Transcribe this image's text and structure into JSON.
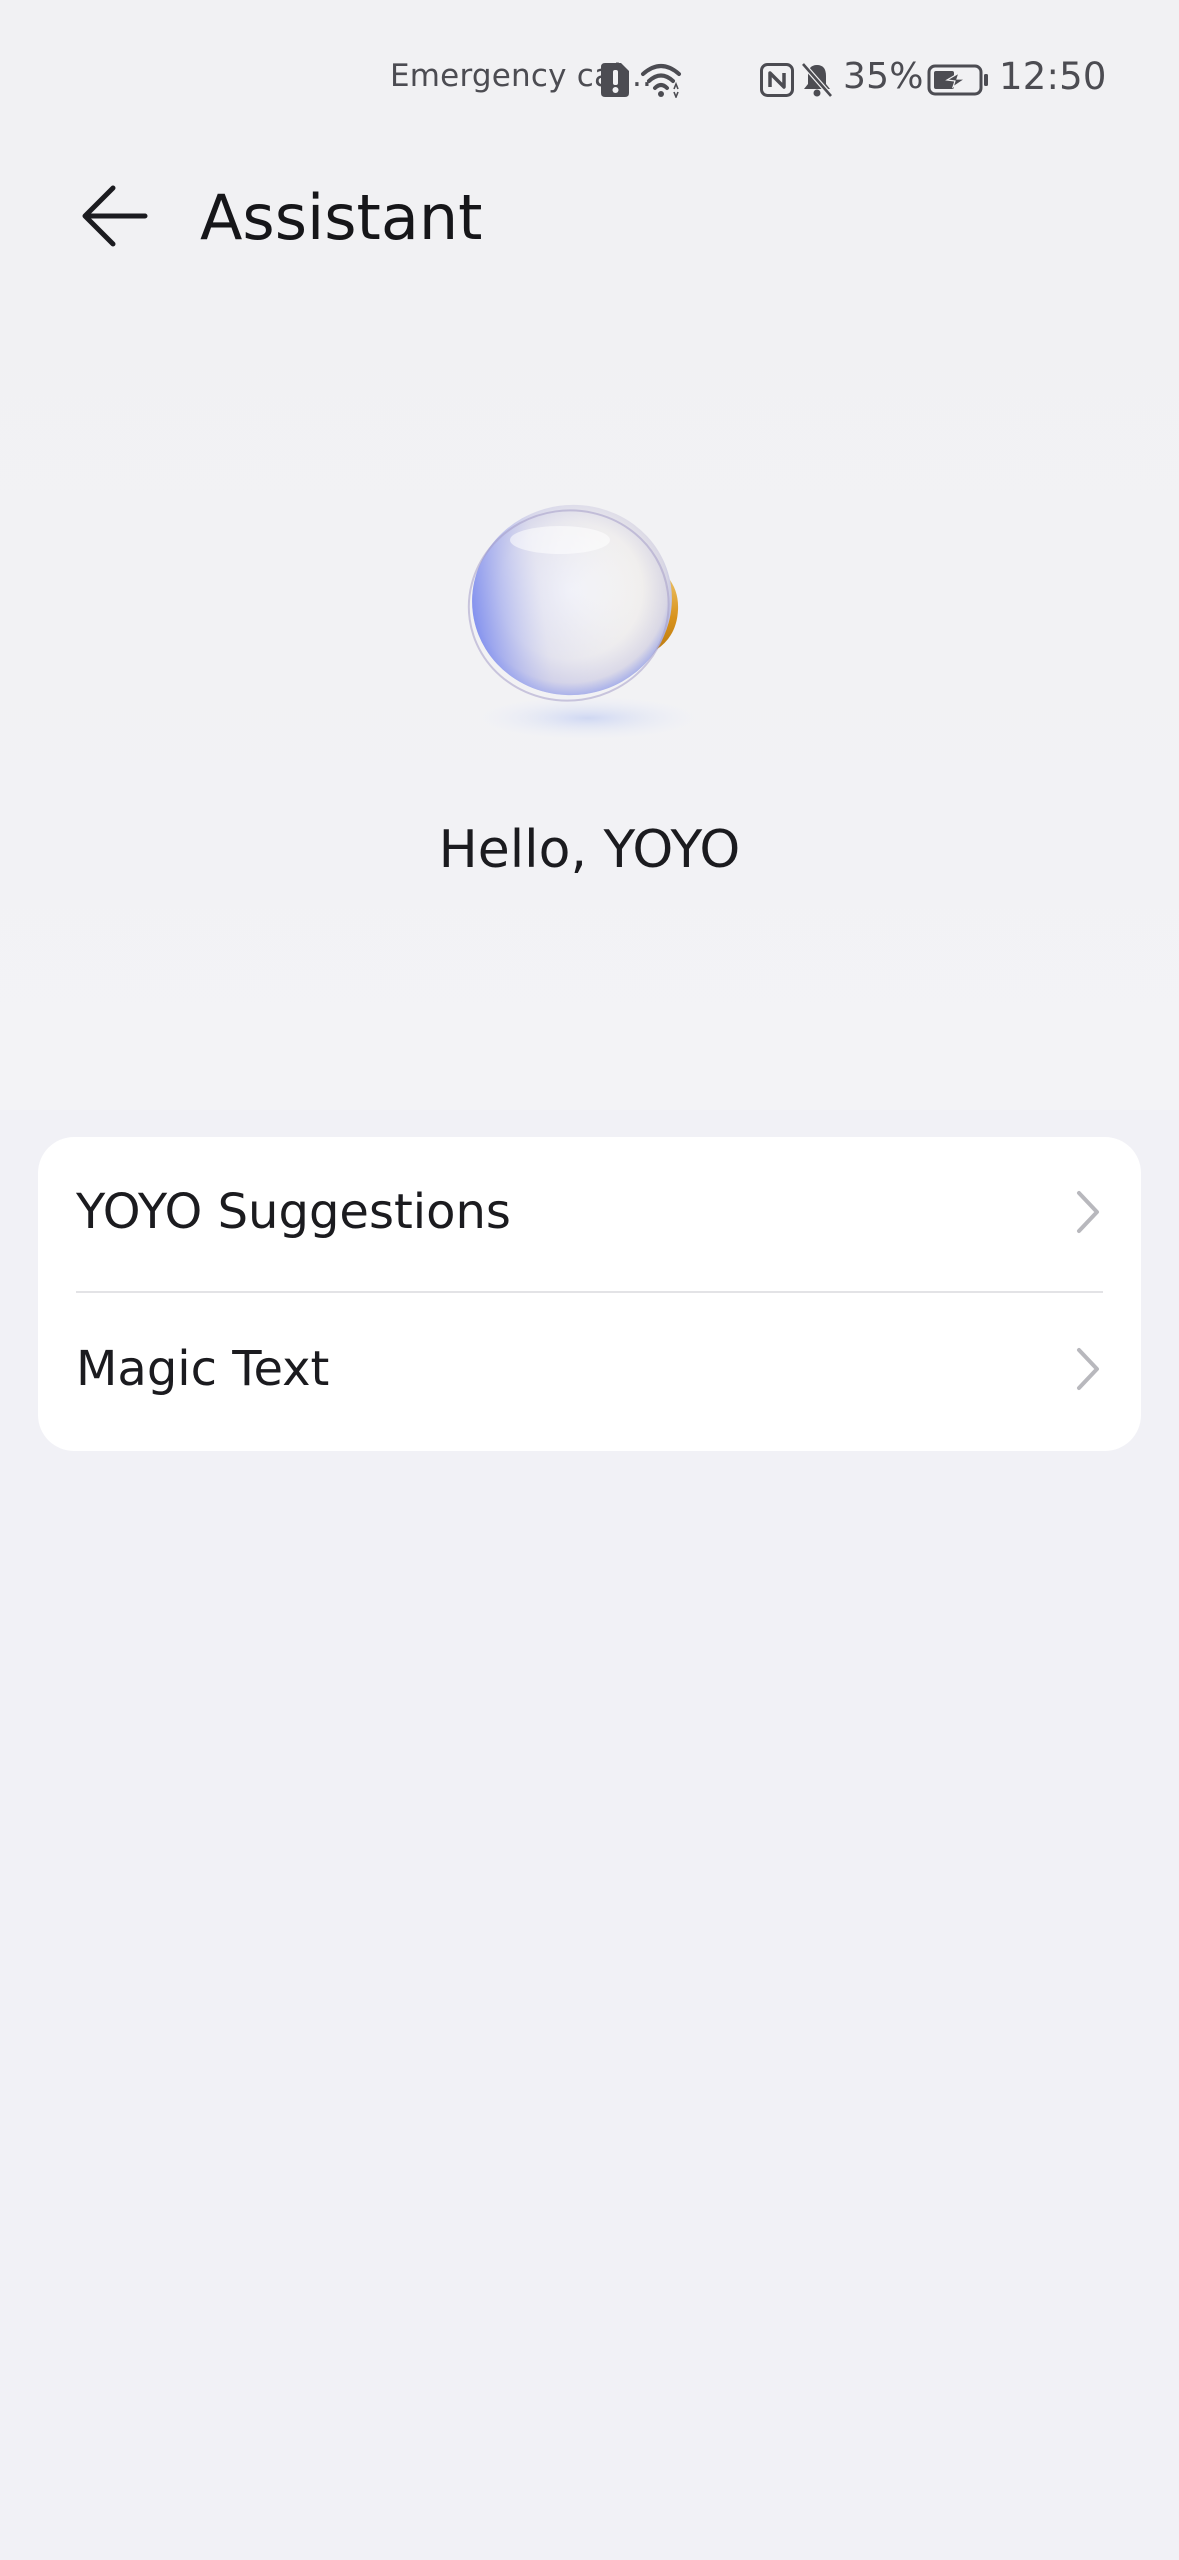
{
  "status_bar": {
    "carrier": "Emergency cal...",
    "battery_percent": "35%",
    "time": "12:50",
    "icons": [
      "sim-alert-icon",
      "wifi-icon",
      "nfc-icon",
      "bell-muted-icon",
      "battery-charging-icon"
    ]
  },
  "header": {
    "back_icon": "arrow-left-icon",
    "title": "Assistant"
  },
  "hero": {
    "orb_icon": "assistant-orb-icon",
    "greeting": "Hello, YOYO"
  },
  "settings": {
    "items": [
      {
        "label": "YOYO Suggestions",
        "icon": "chevron-right-icon"
      },
      {
        "label": "Magic Text",
        "icon": "chevron-right-icon"
      }
    ]
  },
  "colors": {
    "background": "#f1f1f6",
    "card": "#ffffff",
    "text": "#1b1b1f",
    "chevron": "#b8b8bd"
  }
}
